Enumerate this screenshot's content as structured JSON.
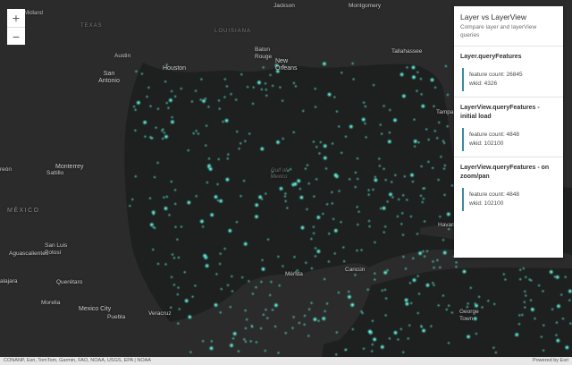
{
  "panel": {
    "title": "Layer vs LayerView",
    "description": "Compare layer and layerView queries",
    "sections": [
      {
        "title": "Layer.queryFeatures",
        "count_text": "feature count: 26845",
        "wkid_text": "wkid: 4326"
      },
      {
        "title": "LayerView.queryFeatures - initial load",
        "count_text": "feature count: 4848",
        "wkid_text": "wkid: 102100"
      },
      {
        "title": "LayerView.queryFeatures - on zoom/pan",
        "count_text": "feature count: 4848",
        "wkid_text": "wkid: 102100"
      }
    ]
  },
  "zoom": {
    "in_symbol": "+",
    "out_symbol": "−"
  },
  "attribution": {
    "sources": "CONANP, Esri, TomTom, Garmin, FAO, NOAA, USGS, EPA | NOAA",
    "powered_by": "Powered by Esri"
  },
  "map_labels": {
    "midland": "Midland",
    "texas": "TEXAS",
    "jackson": "Jackson",
    "montgomery": "Montgomery",
    "louisiana": "LOUISIANA",
    "austin": "Austin",
    "baton_rouge": "Baton Rouge",
    "tallahassee": "Tallahassee",
    "houston": "Houston",
    "new_orleans": "New Orleans",
    "san_antonio": "San Antonio",
    "tampa": "Tampa",
    "gulf": "Gulf of Mexico",
    "monterrey": "Monterrey",
    "saltillo": "Saltillo",
    "torreon": "reón",
    "mexico": "MÉXICO",
    "san_luis_potosi": "San Luis Potosí",
    "aguascalientes": "Aguascalientes",
    "havana": "Havan",
    "cancun": "Cancún",
    "merida": "Mérida",
    "halajara": "alajara",
    "queretaro": "Querétaro",
    "morelia": "Morelia",
    "mexico_city": "Mexico City",
    "puebla": "Puebla",
    "veracruz": "Veracruz",
    "george_town": "George Town"
  },
  "colors": {
    "land": "#2b2b2b",
    "water": "#1e1f1f",
    "point_glow": "#3fd6c8",
    "point_core": "#b8ffd0",
    "panel_bg": "#ffffff",
    "accent": "#3d8a9e"
  },
  "icons": {
    "zoom_in": "plus-icon",
    "zoom_out": "minus-icon"
  }
}
